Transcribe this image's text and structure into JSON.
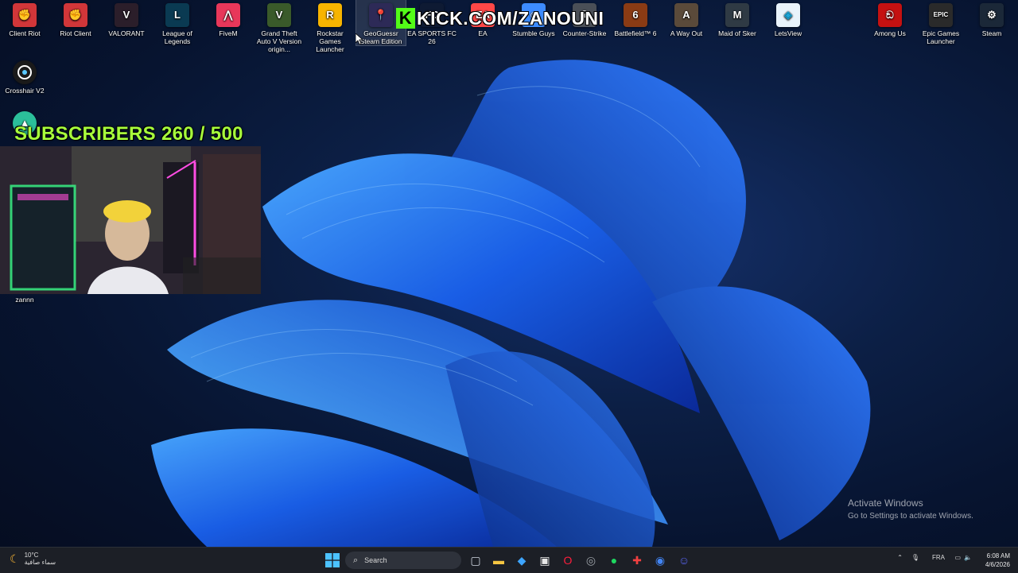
{
  "desktop": {
    "icons_top": [
      {
        "label": "Client Riot",
        "icon": "riot-icon",
        "color": "#d13639",
        "glyph": "✊"
      },
      {
        "label": "Riot Client",
        "icon": "riot-icon",
        "color": "#d13639",
        "glyph": "✊"
      },
      {
        "label": "VALORANT",
        "icon": "valorant-icon",
        "color": "#2b1e2a",
        "glyph": "V"
      },
      {
        "label": "League of Legends",
        "icon": "league-icon",
        "color": "#0a3a52",
        "glyph": "L"
      },
      {
        "label": "FiveM",
        "icon": "fivem-icon",
        "color": "#e8375a",
        "glyph": "⋀"
      },
      {
        "label": "Grand Theft Auto V Version origin...",
        "icon": "gta-icon",
        "color": "#3a5a2a",
        "glyph": "V"
      },
      {
        "label": "Rockstar Games Launcher",
        "icon": "rockstar-icon",
        "color": "#f7b400",
        "glyph": "R"
      },
      {
        "label": "GeoGuessr Steam Edition",
        "icon": "geoguessr-icon",
        "color": "#2d2a57",
        "glyph": "📍"
      },
      {
        "label": "EA SPORTS FC 26",
        "icon": "fc26-icon",
        "color": "#0e1a33",
        "glyph": "FC"
      },
      {
        "label": "EA",
        "icon": "ea-icon",
        "color": "#ff4747",
        "glyph": "EA"
      },
      {
        "label": "Stumble Guys",
        "icon": "stumble-guys-icon",
        "color": "#3d8bff",
        "glyph": "☺"
      },
      {
        "label": "Counter-Strike",
        "icon": "counter-strike-icon",
        "color": "#4a4f57",
        "glyph": "☠"
      },
      {
        "label": "Battlefield™ 6",
        "icon": "battlefield-icon",
        "color": "#8a3b14",
        "glyph": "6"
      },
      {
        "label": "A Way Out",
        "icon": "a-way-out-icon",
        "color": "#5a4a3a",
        "glyph": "A"
      },
      {
        "label": "Maid of Sker",
        "icon": "maid-of-sker-icon",
        "color": "#2f3a44",
        "glyph": "M"
      },
      {
        "label": "LetsView",
        "icon": "letsview-icon",
        "color": "#e9f3fb",
        "glyph": "◈"
      },
      {
        "label": "Among Us",
        "icon": "among-us-icon",
        "color": "#c51111",
        "glyph": "ඞ"
      },
      {
        "label": "Epic Games Launcher",
        "icon": "epic-games-icon",
        "color": "#2a2a2a",
        "glyph": "EPIC"
      },
      {
        "label": "Steam",
        "icon": "steam-icon",
        "color": "#1b2838",
        "glyph": "⚙"
      }
    ],
    "crosshair": {
      "label": "Crosshair V2"
    },
    "webcam_name": "zannn"
  },
  "overlay": {
    "subscribers_text": "SUBSCRIBERS 260 / 500",
    "kick_logo": "K",
    "kick_url": "KICK.COM/ZANOUNI"
  },
  "activate_windows": {
    "title": "Activate Windows",
    "subtitle": "Go to Settings to activate Windows."
  },
  "taskbar": {
    "weather_temp": "10°C",
    "weather_desc": "سماء صافية",
    "search_placeholder": "Search",
    "language": "FRA",
    "time": "6:08 AM",
    "date": "4/6/2026",
    "apps": [
      {
        "name": "task-view-icon",
        "color": "#cfd6e0"
      },
      {
        "name": "file-explorer-icon",
        "color": "#f4c542"
      },
      {
        "name": "copilot-icon",
        "color": "#3da5ff"
      },
      {
        "name": "store-icon",
        "color": "#e8e8e8"
      },
      {
        "name": "opera-gx-icon",
        "color": "#ff1e3c"
      },
      {
        "name": "chrome-dev-icon",
        "color": "#9aa0a6"
      },
      {
        "name": "spotify-icon",
        "color": "#1ed760"
      },
      {
        "name": "red-app-icon",
        "color": "#f04040"
      },
      {
        "name": "chrome-icon",
        "color": "#4285f4"
      },
      {
        "name": "discord-icon",
        "color": "#5865f2"
      }
    ]
  }
}
